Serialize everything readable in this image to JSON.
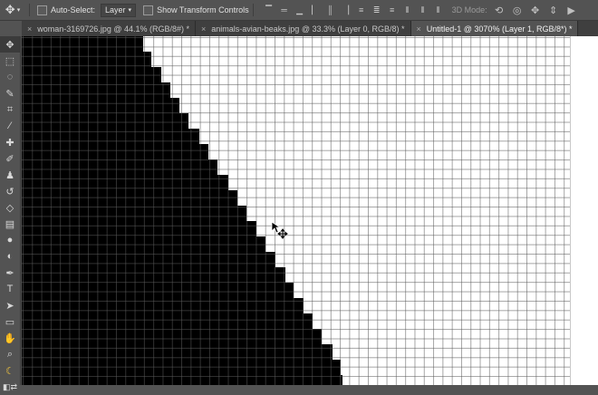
{
  "options_bar": {
    "auto_select_label": "Auto-Select:",
    "auto_select_value": "Layer",
    "show_transform_label": "Show Transform Controls",
    "mode_3d_label": "3D Mode:"
  },
  "tabs": [
    {
      "label": "woman-3169726.jpg @ 44.1% (RGB/8#) *"
    },
    {
      "label": "animals-avian-beaks.jpg @ 33.3% (Layer 0, RGB/8) *"
    },
    {
      "label": "Untitled-1 @ 3070% (Layer 1, RGB/8*) *"
    }
  ],
  "tools": [
    "move-tool",
    "marquee-tool",
    "lasso-tool",
    "quick-select-tool",
    "crop-tool",
    "eyedropper-tool",
    "healing-brush-tool",
    "brush-tool",
    "clone-stamp-tool",
    "history-brush-tool",
    "eraser-tool",
    "gradient-tool",
    "blur-tool",
    "dodge-tool",
    "pen-tool",
    "type-tool",
    "path-select-tool",
    "rectangle-tool",
    "hand-tool",
    "zoom-tool",
    "banana-icon",
    "swap-colors-icon"
  ],
  "pixel_staircase": {
    "color": "#000000",
    "row_right_edges": [
      158,
      167,
      178,
      188,
      198,
      208,
      220,
      230,
      240,
      252,
      262,
      272,
      283,
      293,
      304,
      315,
      324,
      335,
      345,
      355,
      367,
      376,
      378
    ]
  }
}
